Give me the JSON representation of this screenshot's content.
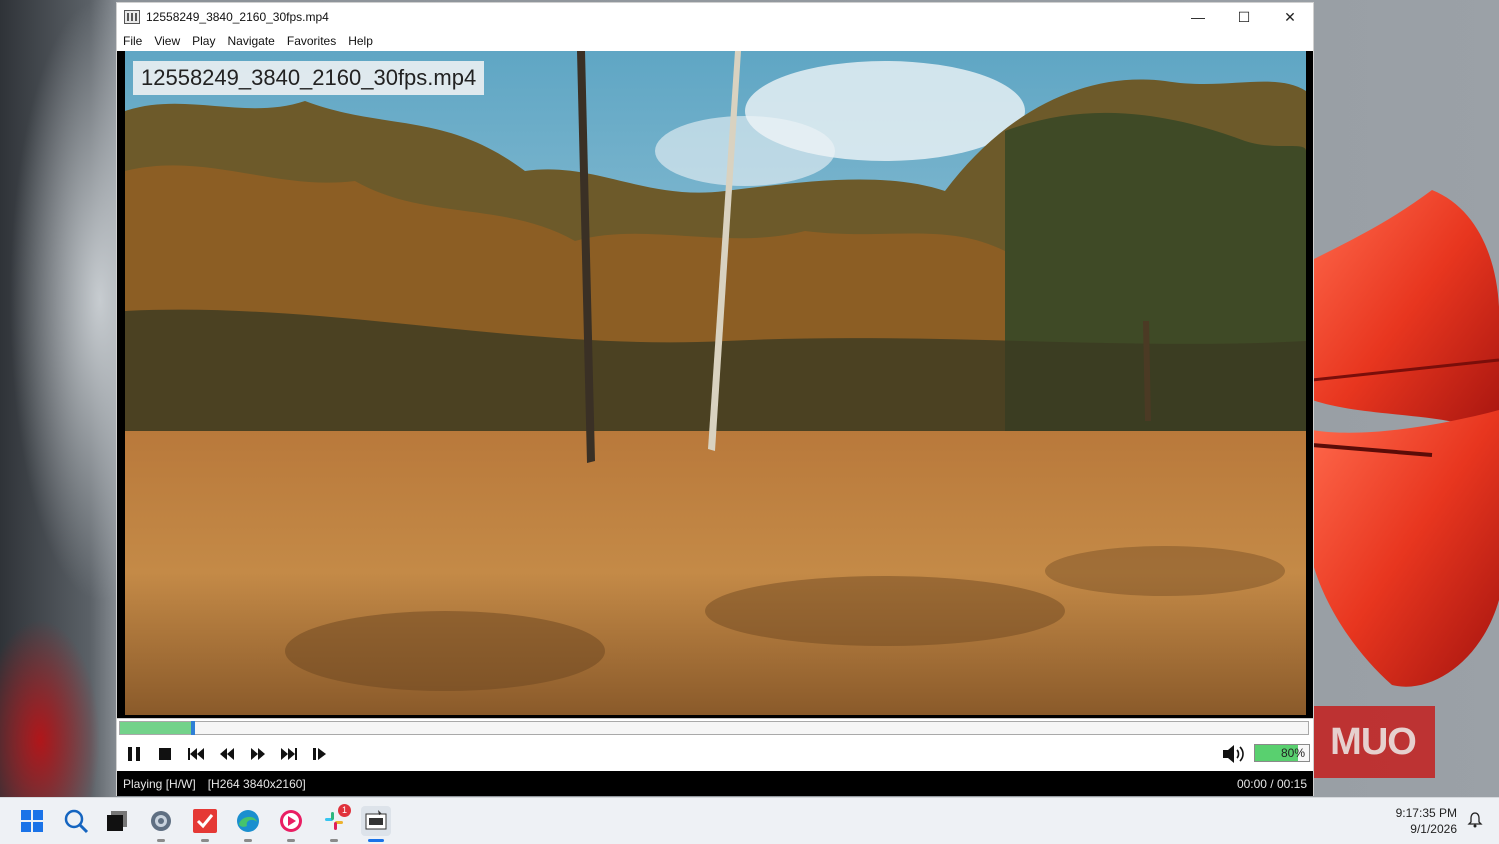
{
  "window": {
    "title": "12558249_3840_2160_30fps.mp4",
    "controls": {
      "minimize": "—",
      "maximize": "☐",
      "close": "✕"
    }
  },
  "menu": [
    "File",
    "View",
    "Play",
    "Navigate",
    "Favorites",
    "Help"
  ],
  "osd_text": "12558249_3840_2160_30fps.mp4",
  "seek": {
    "progress_fraction": 0.06
  },
  "volume": {
    "label": "80%",
    "level_fraction": 0.8
  },
  "status": {
    "state": "Playing [H/W]",
    "codec": "[H264 3840x2160]",
    "time": "00:00 / 00:15"
  },
  "watermark": "MUO",
  "taskbar": {
    "icons": [
      "windows-start-icon",
      "search-icon",
      "task-view-icon",
      "settings-gear-icon",
      "todo-check-icon",
      "edge-browser-icon",
      "media-player-icon",
      "slack-icon",
      "mpc-player-icon"
    ],
    "slack_badge": "1",
    "clock_time": "9:17:35 PM",
    "clock_date": "9/1/2026"
  },
  "colors": {
    "seek_fill": "#73d28a",
    "volume_fill": "#59d06f",
    "seek_thumb": "#2f7fd6",
    "watermark_bg": "#c4201f"
  }
}
